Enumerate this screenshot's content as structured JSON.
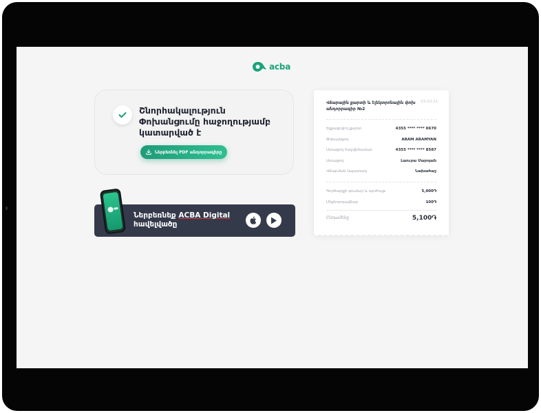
{
  "brand": {
    "logo_text": "acba",
    "accent": "#1aa37a"
  },
  "success": {
    "line1": "Շնորհակալություն",
    "line2": "Փոխանցումը հաջողությամբ",
    "line3": "կատարված է",
    "download_label": "Ներբեռնել PDF անդորրագիրը"
  },
  "banner": {
    "text_prefix": "Ներբեռնեք ",
    "brand_name": "ACBA Digital",
    "text_line2": "հավելվածը"
  },
  "receipt": {
    "title": "Վճարային քարտի և էլեկտրոնային փոխ անդորրագիր №2",
    "date": "03.03.21",
    "rows": [
      {
        "key": "Ելքագրվող քարտ",
        "value": "4355 **** **** 0670"
      },
      {
        "key": "Փոխանցող",
        "value": "ARAM ARAMYAN"
      },
      {
        "key": "Ստացող հաշվեհամար",
        "value": "4355 **** **** 8587"
      },
      {
        "key": "Ստացող",
        "value": "Լաուրա Մարոյան"
      },
      {
        "key": "Վճարման նպատակ",
        "value": "Նախահաշ"
      }
    ],
    "amount_rows": [
      {
        "key": "Գործարքի գումար և արժույթ",
        "value": "5,000֏"
      },
      {
        "key": "Միջնորդավճար",
        "value": "100֏"
      }
    ],
    "total": {
      "key": "Ընդամենը",
      "value": "5,100֏"
    }
  }
}
